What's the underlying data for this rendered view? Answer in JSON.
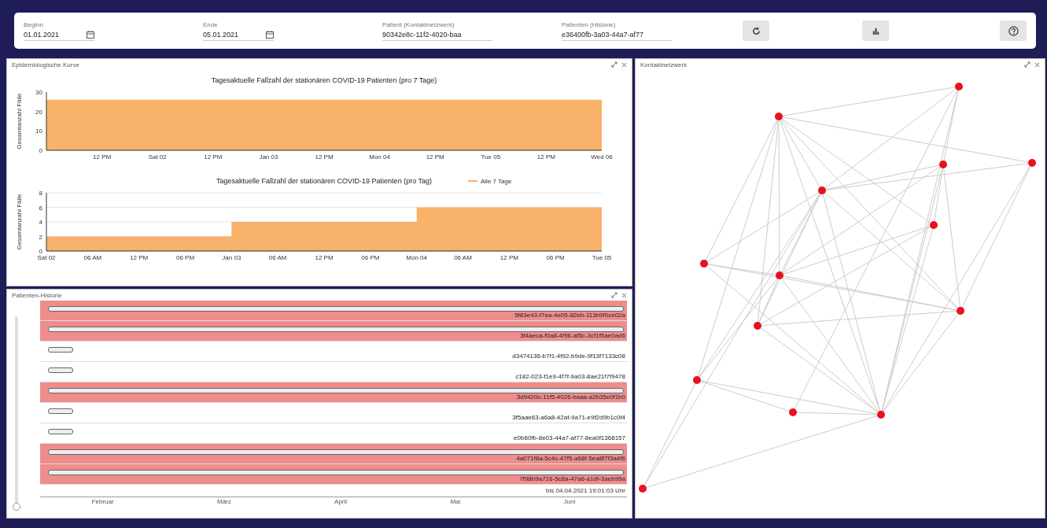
{
  "top_bar": {
    "fields": [
      {
        "label": "Beginn",
        "value": "01.01.2021",
        "kind": "date"
      },
      {
        "label": "Ende",
        "value": "05.01.2021",
        "kind": "date"
      },
      {
        "label": "Patient (Kontaktnetzwerk)",
        "value": "90342e8c-11f2-4020-baa",
        "kind": "text"
      },
      {
        "label": "Patienten (Historie)",
        "value": "e36400fb-3a03-44a7-af77",
        "kind": "text"
      }
    ],
    "buttons": [
      {
        "kind": "refresh"
      },
      {
        "kind": "chart"
      },
      {
        "kind": "help"
      }
    ]
  },
  "epi_panel": {
    "title": "Epidemiologische Kurve",
    "charts": [
      {
        "chart_data": {
          "type": "area",
          "title": "Tagesaktuelle Fallzahl der stationären COVID-19 Patienten (pro 7 Tage)",
          "ylabel": "Gesamtanzahl Fälle",
          "categories": [
            null,
            "12 PM",
            "Sat 02",
            "12 PM",
            "Jan 03",
            "12 PM",
            "Mon 04",
            "12 PM",
            "Tue 05",
            "12 PM",
            "Wed 06"
          ],
          "values": [
            26,
            26,
            26,
            26,
            26,
            26,
            26,
            26,
            26,
            26,
            26
          ],
          "yticks": [
            0,
            10,
            20,
            30
          ],
          "ylim": [
            0,
            30
          ]
        }
      },
      {
        "chart_data": {
          "type": "area",
          "title": "Tagesaktuelle Fallzahl der stationären COVID-19 Patienten (pro Tag)",
          "ylabel": "Gesamtanzahl Fälle",
          "grid": true,
          "categories": [
            "Sat 02",
            "06 AM",
            "12 PM",
            "06 PM",
            "Jan 03",
            "06 AM",
            "12 PM",
            "06 PM",
            "Mon 04",
            "06 AM",
            "12 PM",
            "06 PM",
            "Tue 05"
          ],
          "series": [
            {
              "name": "Alle 7 Tage",
              "color": "#f8b26a",
              "values": [
                2,
                2,
                2,
                2,
                4,
                4,
                4,
                4,
                6,
                6,
                6,
                6,
                6
              ]
            }
          ],
          "yticks": [
            0,
            2,
            4,
            6,
            8
          ],
          "ylim": [
            0,
            8
          ]
        }
      }
    ]
  },
  "timeline_panel": {
    "title": "Patienten-Historie",
    "rows": [
      {
        "id": "5f83e43-f7ea-4e05-82eb-113b9f0ce02a",
        "highlighted": true
      },
      {
        "id": "3f4aeca-f0a8-4f96-af5c-3cf1f5ae0ad6",
        "highlighted": true
      },
      {
        "id": "d3474136-b7f1-4f92-b9de-9f13f7133c08",
        "highlighted": false
      },
      {
        "id": "c182-023-f1e9-4f7f-9a03-8ae21f7f9478",
        "highlighted": false
      },
      {
        "id": "3d9420c-11f5-4026-baaa-a2b35c0f1b0",
        "highlighted": true
      },
      {
        "id": "3f5aae63-a6a8-42af-9a71-e9f2d9b1c0f4",
        "highlighted": false
      },
      {
        "id": "e0b60fb-8e03-44a7-af77-8ea0f1368157",
        "highlighted": false
      },
      {
        "id": "4a071f8a-5c4c-47f5-a68f-5ea8f7f3a4f6",
        "highlighted": true
      },
      {
        "id": "7f98b9a716-5c8a-47a6-a1df-3aeb99a",
        "highlighted": true
      }
    ],
    "slider": {
      "level": 0
    },
    "footer": "bis 04.04.2021 19:01:03 Uhr",
    "axis_labels": [
      "Februar",
      "März",
      "April",
      "Mai",
      "Juni"
    ]
  },
  "network_panel": {
    "title": "Kontaktnetzwerk"
  }
}
